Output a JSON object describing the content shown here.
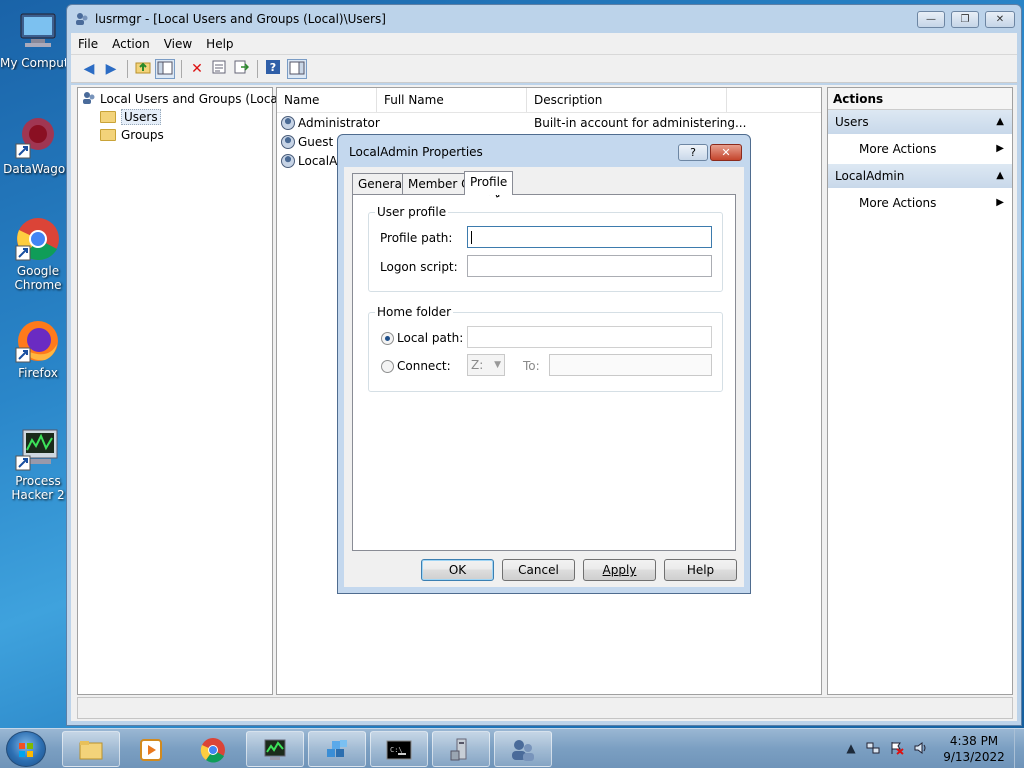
{
  "desktop": {
    "icons": [
      {
        "label": "My Computer"
      },
      {
        "label": "DataWagon"
      },
      {
        "label": "Google Chrome"
      },
      {
        "label": "Firefox"
      },
      {
        "label": "Process Hacker 2"
      }
    ]
  },
  "window": {
    "title": "lusrmgr - [Local Users and Groups (Local)\\Users]",
    "controls": {
      "minimize": "—",
      "maximize": "❐",
      "close": "✕"
    }
  },
  "menu": {
    "items": [
      "File",
      "Action",
      "View",
      "Help"
    ]
  },
  "tree": {
    "root": "Local Users and Groups (Local)",
    "children": [
      "Users",
      "Groups"
    ]
  },
  "list": {
    "columns": [
      "Name",
      "Full Name",
      "Description"
    ],
    "rows": [
      {
        "name": "Administrator",
        "full_name": "",
        "description": "Built-in account for administering..."
      },
      {
        "name": "Guest",
        "full_name": "",
        "description": ""
      },
      {
        "name": "LocalAd",
        "full_name": "",
        "description": ""
      }
    ]
  },
  "actions": {
    "header": "Actions",
    "groups": [
      {
        "title": "Users",
        "items": [
          "More Actions"
        ]
      },
      {
        "title": "LocalAdmin",
        "items": [
          "More Actions"
        ]
      }
    ]
  },
  "dialog": {
    "title": "LocalAdmin Properties",
    "help": "?",
    "close": "✕",
    "tabs": [
      "General",
      "Member Of",
      "Profile"
    ],
    "active_tab": "Profile",
    "user_profile": {
      "legend": "User profile",
      "profile_path_label": "Profile path:",
      "profile_path_value": "",
      "logon_script_label": "Logon script:",
      "logon_script_value": ""
    },
    "home_folder": {
      "legend": "Home folder",
      "local_path_label": "Local path:",
      "local_path_value": "",
      "connect_label": "Connect:",
      "drive_value": "Z:",
      "to_label": "To:",
      "to_value": "",
      "selected": "Local path"
    },
    "buttons": {
      "ok": "OK",
      "cancel": "Cancel",
      "apply": "Apply",
      "help": "Help"
    }
  },
  "taskbar": {
    "clock_time": "4:38 PM",
    "clock_date": "9/13/2022"
  },
  "colors": {
    "accent": "#3c7fb1",
    "title_bar": "#bcd3ea",
    "close_red": "#c4452c"
  }
}
